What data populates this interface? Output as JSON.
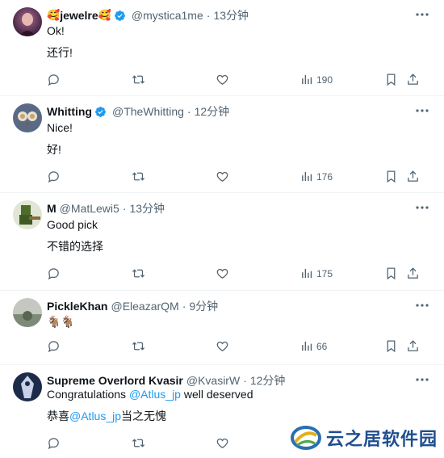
{
  "tweets": [
    {
      "name": "jewelre",
      "name_prefix_emoji": "🥰",
      "name_suffix_emoji": "🥰",
      "verified": true,
      "handle": "@mystica1me",
      "dot": "·",
      "time": "13分钟",
      "lines": [
        "Ok!",
        "还行!"
      ],
      "views": "190",
      "avatar_colors": [
        "#3b1f3b",
        "#a86a8f"
      ]
    },
    {
      "name": "Whitting",
      "verified": true,
      "handle": "@TheWhitting",
      "dot": "·",
      "time": "12分钟",
      "lines": [
        "Nice!",
        "好!"
      ],
      "views": "176",
      "avatar_colors": [
        "#5a6a85",
        "#c9a36b"
      ]
    },
    {
      "name": "M",
      "verified": false,
      "handle": "@MatLewi5",
      "dot": "·",
      "time": "13分钟",
      "lines": [
        "Good pick",
        "不错的选择"
      ],
      "views": "175",
      "avatar_colors": [
        "#4f6b2a",
        "#8a6a3a"
      ]
    },
    {
      "name": "PickleKhan",
      "verified": false,
      "handle": "@EleazarQM",
      "dot": "·",
      "time": "9分钟",
      "lines": [
        "🐐🐐"
      ],
      "views": "66",
      "avatar_colors": [
        "#7d8a78",
        "#c4c8c0"
      ]
    },
    {
      "name": "Supreme Overlord Kvasir",
      "verified": false,
      "handle": "@KvasirW",
      "dot": "·",
      "time": "12分钟",
      "line1_pre": "Congratulations ",
      "line1_mention": "@Atlus_jp",
      "line1_post": " well deserved",
      "line2_pre": "恭喜",
      "line2_mention": "@Atlus_jp",
      "line2_post": "当之无愧",
      "avatar_colors": [
        "#1d2b4a",
        "#c7d2e6"
      ]
    }
  ],
  "watermark": {
    "text": "云之居软件园"
  },
  "icons": {
    "reply": "reply-icon",
    "retweet": "retweet-icon",
    "like": "like-icon",
    "views": "views-icon",
    "bookmark": "bookmark-icon",
    "share": "share-icon",
    "more": "more-icon",
    "verified": "verified-badge-icon"
  },
  "colors": {
    "verified": "#1d9bf0",
    "mention": "#1d9bf0",
    "secondary_text": "#536471"
  }
}
